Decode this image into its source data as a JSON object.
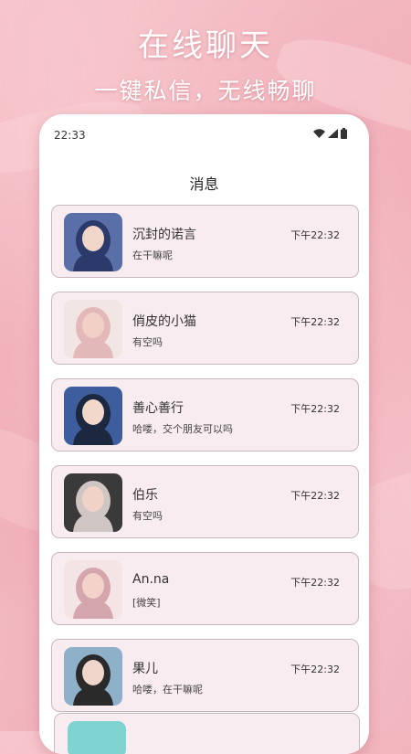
{
  "promo": {
    "title": "在线聊天",
    "subtitle": "一键私信，无线畅聊"
  },
  "status_bar": {
    "time": "22:33",
    "icons": [
      "wifi-icon",
      "signal-icon",
      "battery-icon"
    ]
  },
  "page": {
    "title": "消息"
  },
  "conversations": [
    {
      "name": "沉封的诺言",
      "message": "在干嘛呢",
      "time": "下午22:32",
      "avatar_colors": [
        "#5a6fa8",
        "#f0d6c9",
        "#2b3a6b"
      ]
    },
    {
      "name": "俏皮的小猫",
      "message": "有空吗",
      "time": "下午22:32",
      "avatar_colors": [
        "#f2e6e4",
        "#f1d0c5",
        "#e3b8b8"
      ]
    },
    {
      "name": "善心善行",
      "message": "哈喽，交个朋友可以吗",
      "time": "下午22:32",
      "avatar_colors": [
        "#3e5d9c",
        "#f2d7cb",
        "#1c2740"
      ]
    },
    {
      "name": "伯乐",
      "message": "有空吗",
      "time": "下午22:32",
      "avatar_colors": [
        "#3a3a3a",
        "#f0d2c7",
        "#cfc6c4"
      ]
    },
    {
      "name": "An.na",
      "message": "[微笑]",
      "time": "下午22:32",
      "avatar_colors": [
        "#f4e4e6",
        "#f3d3c9",
        "#d4a5ad"
      ]
    },
    {
      "name": "果儿",
      "message": "哈喽，在干嘛呢",
      "time": "下午22:32",
      "avatar_colors": [
        "#8fb0c9",
        "#efd6cb",
        "#2a2a2a"
      ]
    }
  ]
}
